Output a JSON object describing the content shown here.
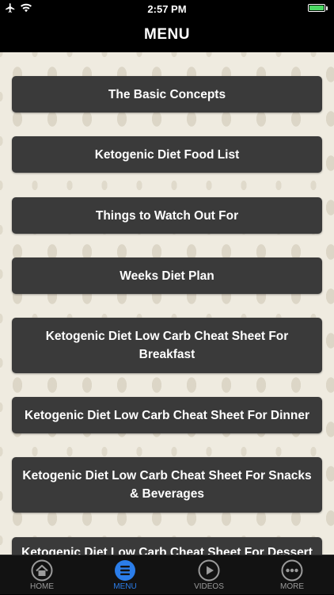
{
  "status_bar": {
    "time": "2:57 PM",
    "battery_level": 1.0,
    "battery_color": "#4cd964"
  },
  "nav": {
    "title": "MENU"
  },
  "menu": {
    "items": [
      {
        "label": "The Basic Concepts"
      },
      {
        "label": "Ketogenic Diet Food List"
      },
      {
        "label": "Things to Watch Out For"
      },
      {
        "label": "Weeks Diet Plan"
      },
      {
        "label": "Ketogenic Diet Low Carb Cheat Sheet For Breakfast"
      },
      {
        "label": "Ketogenic Diet Low Carb Cheat Sheet For Dinner"
      },
      {
        "label": "Ketogenic Diet Low Carb Cheat Sheet For Snacks & Beverages"
      },
      {
        "label": "Ketogenic Diet Low Carb Cheat Sheet For Dessert &"
      }
    ]
  },
  "tab_bar": {
    "active_color": "#2b7de9",
    "inactive_color": "#9b9b9b",
    "tabs": [
      {
        "label": "HOME",
        "icon": "home-icon"
      },
      {
        "label": "MENU",
        "icon": "menu-list-icon",
        "active": true
      },
      {
        "label": "VIDEOS",
        "icon": "play-icon"
      },
      {
        "label": "MORE",
        "icon": "more-dots-icon"
      }
    ]
  }
}
